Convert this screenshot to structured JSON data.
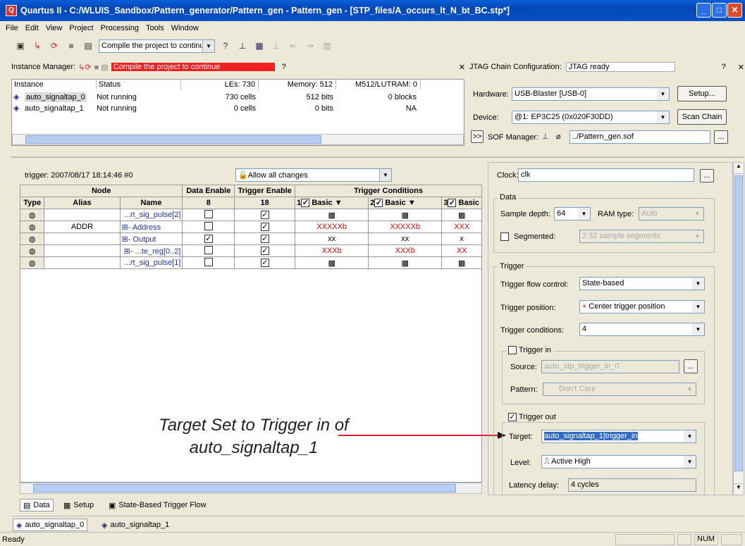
{
  "title": "Quartus II - C:/WLUIS_Sandbox/Pattern_generator/Pattern_gen - Pattern_gen - [STP_files/A_occurs_lt_N_bt_BC.stp*]",
  "menu": [
    "File",
    "Edit",
    "View",
    "Project",
    "Processing",
    "Tools",
    "Window"
  ],
  "toolbar": {
    "compile_status": "Compile the project to continue"
  },
  "instance_manager": {
    "label": "Instance Manager:",
    "status": "Compile the project to continue",
    "columns": [
      "Instance",
      "Status",
      "LEs: 730",
      "Memory: 512",
      "M512/LUTRAM: 0"
    ],
    "rows": [
      {
        "instance": "auto_signaltap_0",
        "status": "Not running",
        "les": "730 cells",
        "memory": "512 bits",
        "m512": "0 blocks"
      },
      {
        "instance": "auto_signaltap_1",
        "status": "Not running",
        "les": "0 cells",
        "memory": "0 bits",
        "m512": "NA"
      }
    ]
  },
  "jtag": {
    "label": "JTAG Chain Configuration:",
    "status": "JTAG ready",
    "hardware_label": "Hardware:",
    "hardware": "USB-Blaster [USB-0]",
    "setup": "Setup...",
    "device_label": "Device:",
    "device": "@1: EP3C25 (0x020F30DD)",
    "scan_chain": "Scan Chain",
    "sof_label": "SOF Manager:",
    "sof_file": "../Pattern_gen.sof",
    "browse": "..."
  },
  "trigger_header": {
    "label": "trigger: 2007/08/17 18:14:46  #0",
    "allow": "Allow all changes"
  },
  "grid": {
    "headers": {
      "node": "Node",
      "data_enable": "Data Enable",
      "trigger_enable": "Trigger Enable",
      "trigger_conditions": "Trigger Conditions",
      "type": "Type",
      "alias": "Alias",
      "name": "Name",
      "de_count": "8",
      "te_count": "18",
      "cond1": "1",
      "cond2": "2",
      "cond3": "3",
      "basic": "Basic"
    },
    "rows": [
      {
        "alias": "",
        "name": "...rt_sig_pulse[2]",
        "de": "",
        "te": "✓",
        "c1": "▩",
        "c2": "▩",
        "c3": "▩"
      },
      {
        "alias": "ADDR",
        "name": "⊞- Address",
        "de": "",
        "te": "✓",
        "c1": "XXXXXb",
        "c2": "XXXXXb",
        "c3": "XXX"
      },
      {
        "alias": "",
        "name": "⊞- Output",
        "de": "✓",
        "te": "✓",
        "c1": "xx",
        "c2": "xx",
        "c3": "x"
      },
      {
        "alias": "",
        "name": "⊞- ...te_reg[0..2]",
        "de": "",
        "te": "✓",
        "c1": "XXXb",
        "c2": "XXXb",
        "c3": "XX"
      },
      {
        "alias": "",
        "name": "...rt_sig_pulse[1]",
        "de": "",
        "te": "✓",
        "c1": "▩",
        "c2": "▩",
        "c3": "▩"
      }
    ]
  },
  "annotation": {
    "line1": "Target Set to Trigger in of",
    "line2": "auto_signaltap_1"
  },
  "tabs": [
    "Data",
    "Setup",
    "State-Based Trigger Flow"
  ],
  "instance_tabs": [
    "auto_signaltap_0",
    "auto_signaltap_1"
  ],
  "settings": {
    "clock_label": "Clock:",
    "clock": "clk",
    "data_group": "Data",
    "sample_depth_label": "Sample depth:",
    "sample_depth": "64",
    "ram_type_label": "RAM type:",
    "ram_type": "Auto",
    "segmented": "Segmented:",
    "segments": "2  32 sample segments",
    "trigger_group": "Trigger",
    "flow_label": "Trigger flow control:",
    "flow": "State-based",
    "position_label": "Trigger position:",
    "position": "Center trigger position",
    "conditions_label": "Trigger conditions:",
    "conditions": "4",
    "trigger_in": "Trigger in",
    "source_label": "Source:",
    "source": "auto_stp_trigger_in_0",
    "pattern_label": "Pattern:",
    "pattern": "Don't Care",
    "trigger_out": "Trigger out",
    "target_label": "Target:",
    "target": "auto_signaltap_1|trigger_in",
    "level_label": "Level:",
    "level": "Active High",
    "latency_label": "Latency delay:",
    "latency": "4 cycles"
  },
  "status": {
    "ready": "Ready",
    "num": "NUM"
  }
}
